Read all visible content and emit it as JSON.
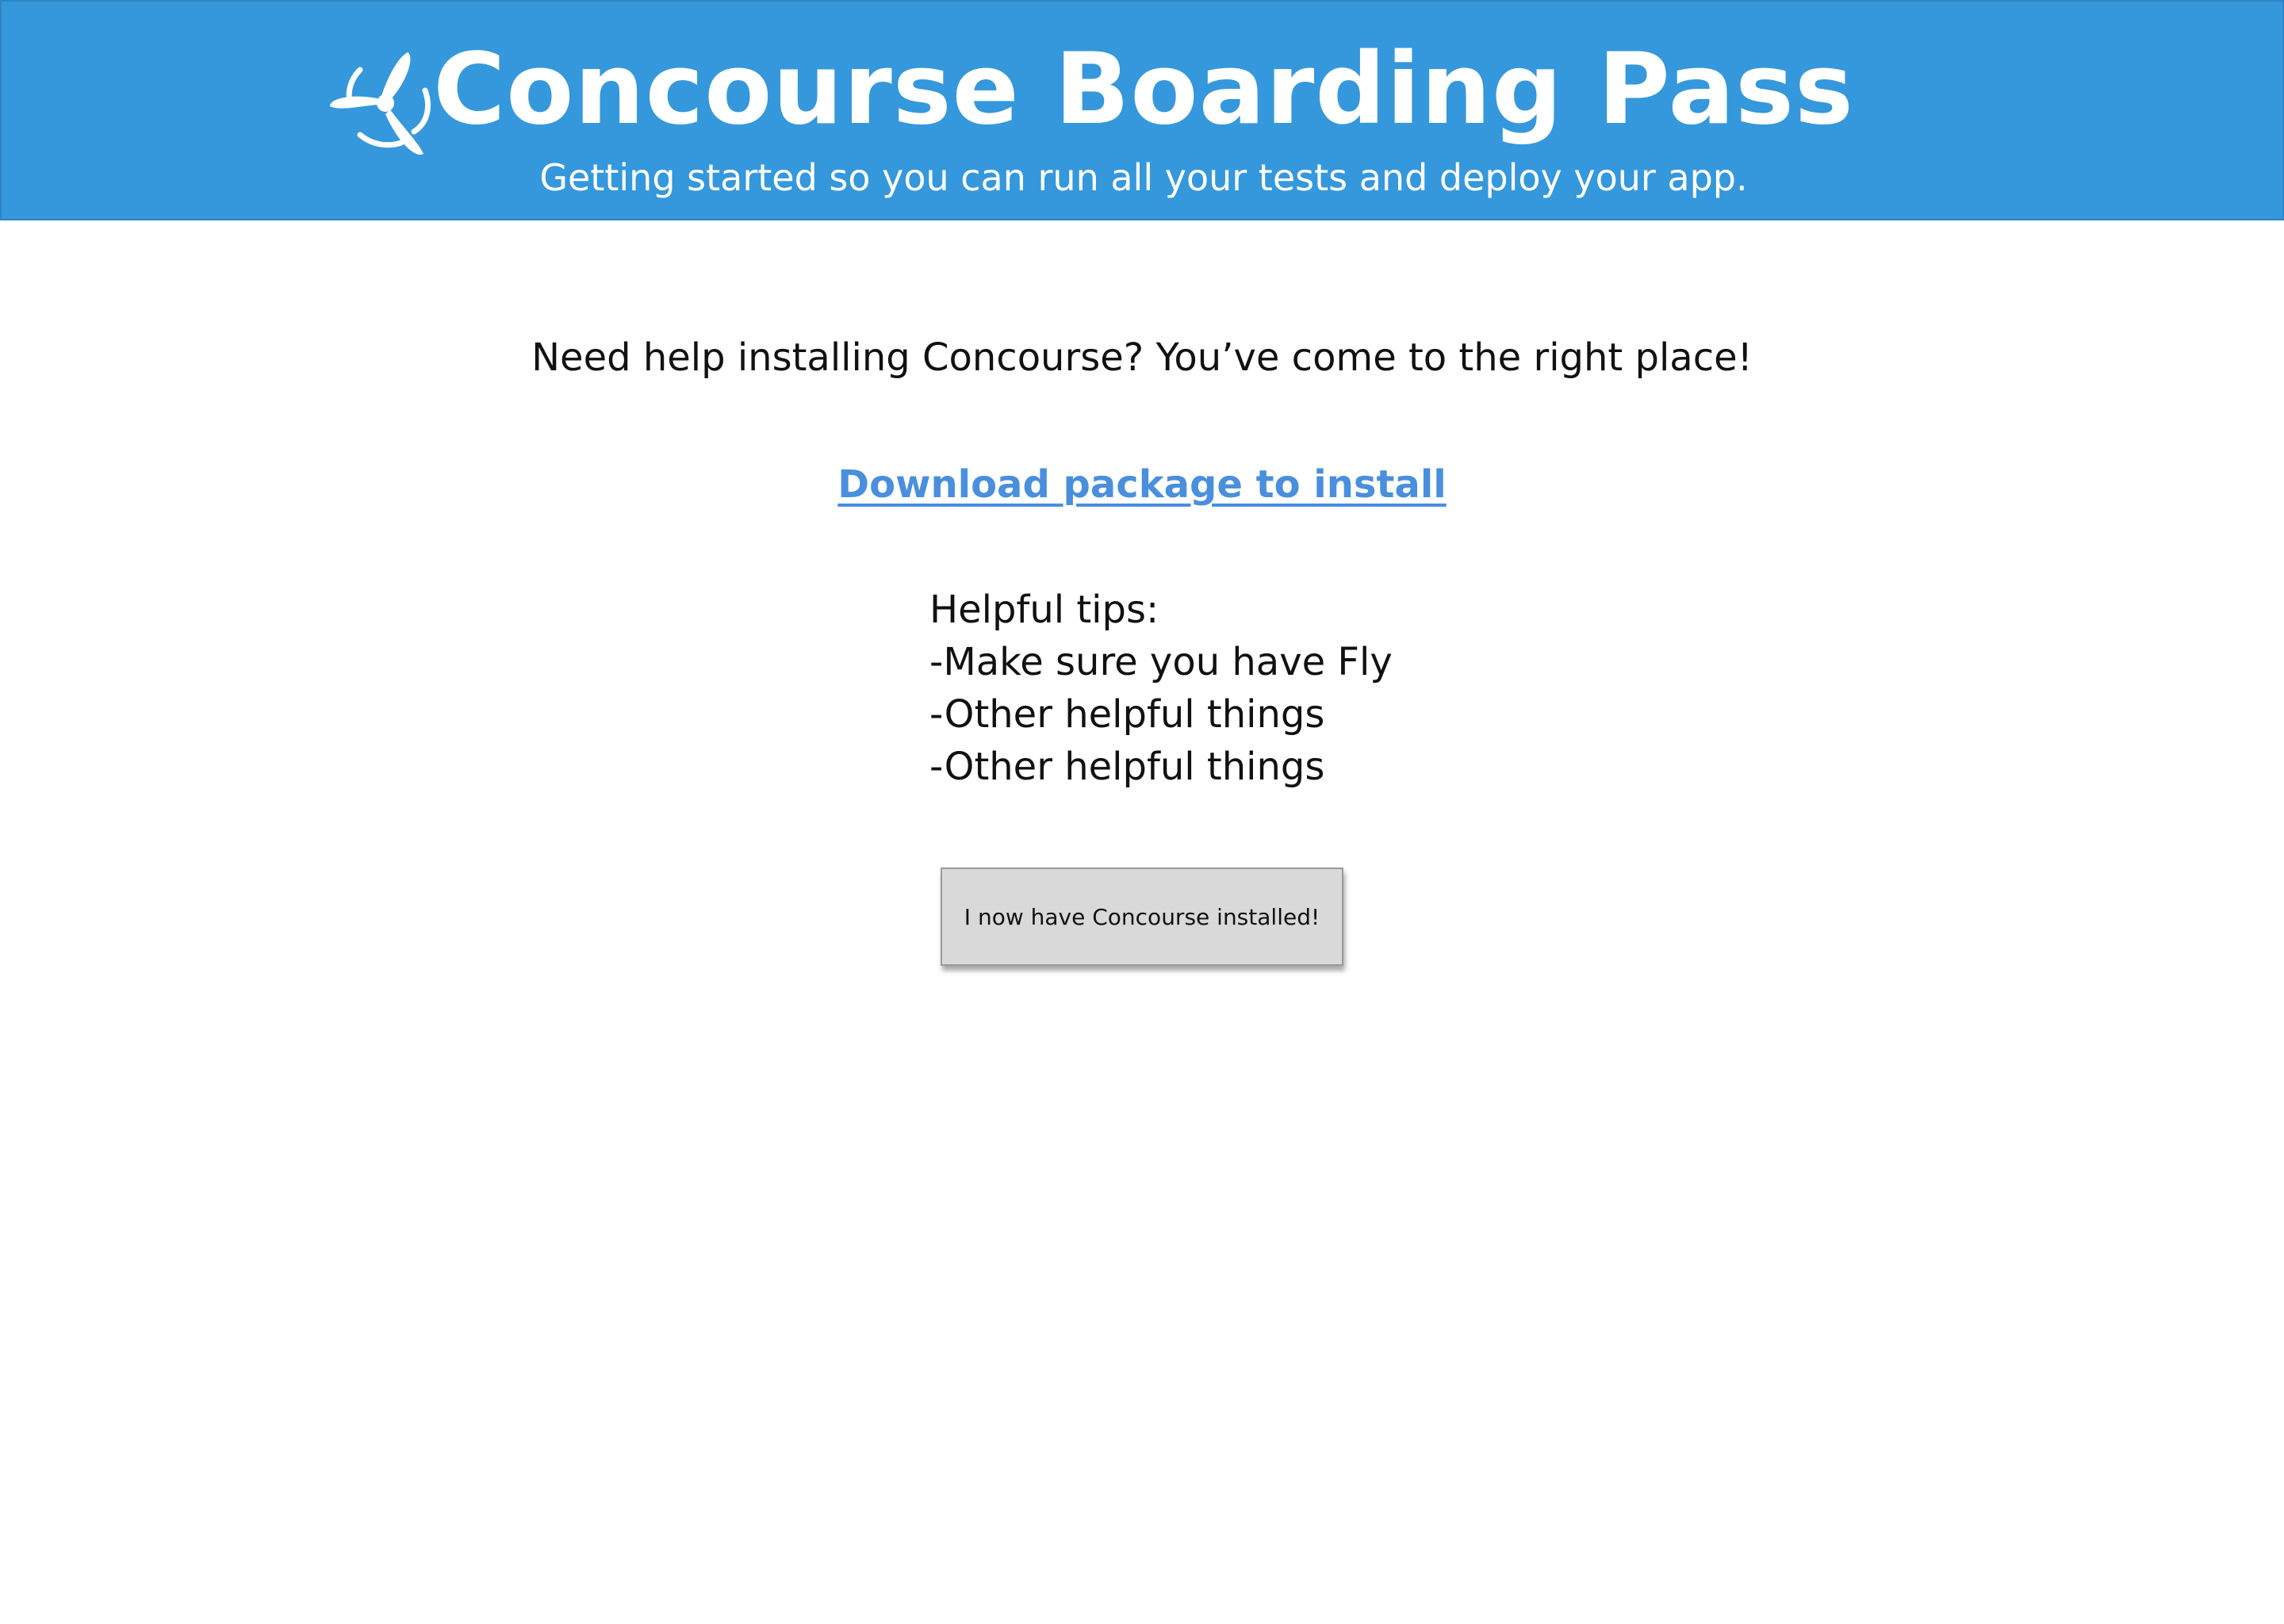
{
  "header": {
    "title": "Concourse Boarding Pass",
    "subtitle": "Getting started so you can run all your tests and deploy your app.",
    "logo_icon": "concourse-propeller-icon",
    "background_color": "#3598dc"
  },
  "main": {
    "intro": "Need help installing Concourse? You’ve come to the right place!",
    "download_link": "Download package to install",
    "link_color": "#4a8fdd",
    "tips": [
      "Helpful tips:",
      "-Make sure you have Fly",
      "-Other helpful things",
      "-Other helpful things"
    ],
    "installed_button": "I now have Concourse installed!"
  }
}
